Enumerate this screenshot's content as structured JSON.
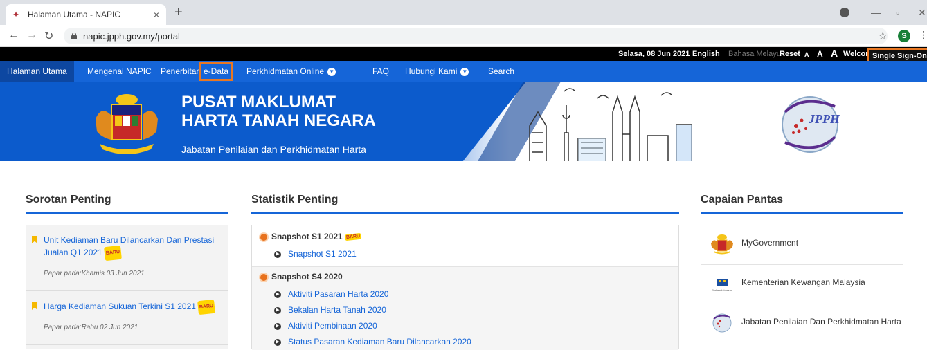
{
  "browser": {
    "tab_title": "Halaman Utama - NAPIC",
    "tab_close": "×",
    "new_tab": "+",
    "url": "napic.jpph.gov.my/portal",
    "profile_initial": "S"
  },
  "topstrip": {
    "date": "Selasa, 08 Jun 2021",
    "lang_en": "English",
    "lang_sep": "|",
    "lang_ms": "Bahasa Melayu",
    "reset": "Reset",
    "font_small": "A",
    "font_medium": "A",
    "font_large": "A",
    "welcome": "Welcome!",
    "sso": "Single Sign-On"
  },
  "nav": {
    "home": "Halaman Utama",
    "about": "Mengenai NAPIC",
    "publications": "Penerbitan",
    "edata": "e-Data",
    "online": "Perkhidmatan Online",
    "faq": "FAQ",
    "contact": "Hubungi Kami",
    "search": "Search"
  },
  "banner": {
    "title_line1": "PUSAT MAKLUMAT",
    "title_line2": "HARTA TANAH NEGARA",
    "subtitle": "Jabatan Penilaian dan Perkhidmatan Harta",
    "jpph_text": "JPPH"
  },
  "sorotan": {
    "title": "Sorotan Penting",
    "items": [
      {
        "title": "Unit Kediaman Baru Dilancarkan Dan Prestasi Jualan Q1 2021",
        "badge": "BARU",
        "date": "Papar pada:Khamis 03 Jun 2021"
      },
      {
        "title": "Harga Kediaman Sukuan Terkini S1 2021",
        "badge": "BARU",
        "date": "Papar pada:Rabu 02 Jun 2021"
      }
    ]
  },
  "statistik": {
    "title": "Statistik Penting",
    "groups": [
      {
        "heading": "Snapshot S1 2021",
        "badge": "BARU",
        "links": [
          "Snapshot S1 2021"
        ]
      },
      {
        "heading": "Snapshot S4 2020",
        "links": [
          "Aktiviti Pasaran Harta 2020",
          "Bekalan Harta Tanah 2020",
          "Aktiviti Pembinaan 2020",
          "Status Pasaran Kediaman Baru Dilancarkan 2020"
        ]
      }
    ]
  },
  "capaian": {
    "title": "Capaian Pantas",
    "items": [
      {
        "label": "MyGovernment"
      },
      {
        "label": "Kementerian Kewangan Malaysia",
        "logo_caption": "Perbendaharaan"
      },
      {
        "label": "Jabatan Penilaian Dan Perkhidmatan Harta"
      }
    ]
  },
  "colors": {
    "nav_blue": "#1565d8",
    "highlight_orange": "#e87722",
    "bookmark_yellow": "#f5b800"
  }
}
